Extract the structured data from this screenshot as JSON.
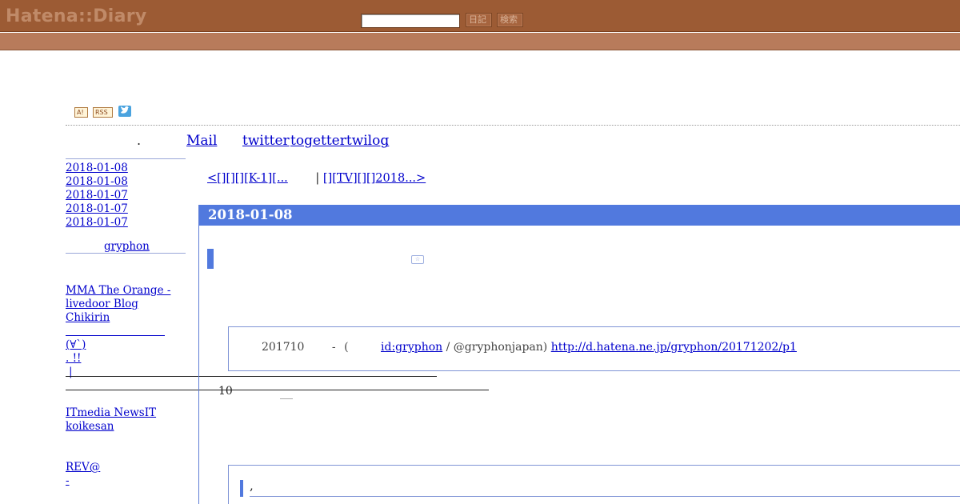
{
  "header": {
    "logo": "Hatena::Diary",
    "search_value": "",
    "diary_button": "日記",
    "search_button": "検索"
  },
  "feed_icons": {
    "antenna": "A!",
    "rss": "RSS"
  },
  "top_links": {
    "dot": ".",
    "mail": "Mail",
    "twitter": "twitter",
    "togetter": "togettertwilog",
    "dot2": "."
  },
  "sidebar": {
    "recent_dates": [
      "2018-01-08",
      "2018-01-08",
      "2018-01-07",
      "2018-01-07",
      "2018-01-07"
    ],
    "profile_name": "gryphon",
    "links": {
      "mma": "MMA The Orange -",
      "livedoor": "livedoor Blog",
      "chikirin": "Chikirin",
      "face": "(∀`)",
      "excl": ". !!",
      "bar": "|",
      "itmedia": "ITmedia NewsIT",
      "koikesan": "koikesan",
      "rev": "REV@",
      "dash": "-"
    }
  },
  "nav": {
    "prev": "<[][][][K-1][...",
    "sep": "|",
    "next": "[][TV][][]2018...>"
  },
  "entry": {
    "date": "2018-01-08",
    "star": "☆",
    "quote_year": "201710",
    "quote_dash": "-",
    "quote_paren": "(",
    "quote_id": "id:gryphon",
    "quote_twitter": "/ @gryphonjapan)",
    "quote_url": "http://d.hatena.ne.jp/gryphon/20171202/p1",
    "ten": "10",
    "comma": ","
  },
  "colors": {
    "header_bg": "#9c5b34",
    "subheader_bg": "#b87b5b",
    "date_band": "#5179de",
    "link": "#0000cc"
  }
}
